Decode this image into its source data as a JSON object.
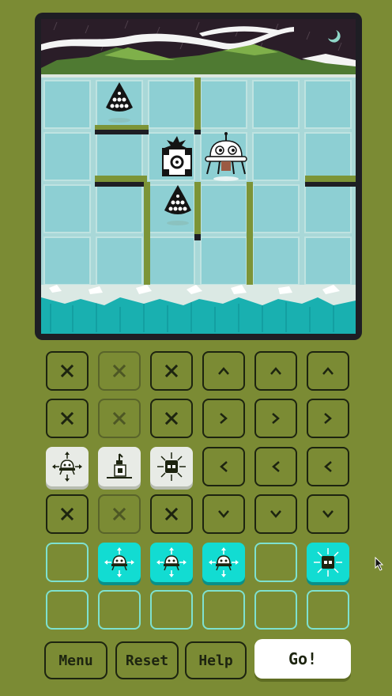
{
  "board": {
    "rows": 4,
    "cols": 6,
    "pieces": [
      {
        "name": "spiked-bomb-robot-icon",
        "row": 0,
        "col": 1
      },
      {
        "name": "spiked-bomb-robot-icon",
        "row": 2,
        "col": 2
      },
      {
        "name": "target-crate-icon",
        "row": 1,
        "col": 2
      },
      {
        "name": "white-ufo-robot-icon",
        "row": 1,
        "col": 3
      }
    ]
  },
  "grid": {
    "rows": [
      [
        {
          "kind": "x",
          "icon": "x-icon"
        },
        {
          "kind": "x-dim",
          "icon": "x-icon"
        },
        {
          "kind": "x",
          "icon": "x-icon"
        },
        {
          "kind": "arrow",
          "icon": "arrow-up-icon"
        },
        {
          "kind": "arrow",
          "icon": "arrow-up-icon"
        },
        {
          "kind": "arrow",
          "icon": "arrow-up-icon"
        }
      ],
      [
        {
          "kind": "x",
          "icon": "x-icon"
        },
        {
          "kind": "x-dim",
          "icon": "x-icon"
        },
        {
          "kind": "x",
          "icon": "x-icon"
        },
        {
          "kind": "arrow",
          "icon": "arrow-right-icon"
        },
        {
          "kind": "arrow",
          "icon": "arrow-right-icon"
        },
        {
          "kind": "arrow",
          "icon": "arrow-right-icon"
        }
      ],
      [
        {
          "kind": "tile-white",
          "icon": "robot-move-icon"
        },
        {
          "kind": "tile-white",
          "icon": "robot-push-icon"
        },
        {
          "kind": "tile-white",
          "icon": "block-burst-icon"
        },
        {
          "kind": "arrow",
          "icon": "arrow-left-icon"
        },
        {
          "kind": "arrow",
          "icon": "arrow-left-icon"
        },
        {
          "kind": "arrow",
          "icon": "arrow-left-icon"
        }
      ],
      [
        {
          "kind": "x",
          "icon": "x-icon"
        },
        {
          "kind": "x-dim",
          "icon": "x-icon"
        },
        {
          "kind": "x",
          "icon": "x-icon"
        },
        {
          "kind": "arrow",
          "icon": "arrow-down-icon"
        },
        {
          "kind": "arrow",
          "icon": "arrow-down-icon"
        },
        {
          "kind": "arrow",
          "icon": "arrow-down-icon"
        }
      ],
      [
        {
          "kind": "empty",
          "icon": ""
        },
        {
          "kind": "tile-cyan",
          "icon": "robot-move-icon"
        },
        {
          "kind": "tile-cyan",
          "icon": "robot-move-icon"
        },
        {
          "kind": "tile-cyan",
          "icon": "robot-move-icon"
        },
        {
          "kind": "empty",
          "icon": ""
        },
        {
          "kind": "tile-cyan",
          "icon": "block-burst-icon"
        }
      ],
      [
        {
          "kind": "empty",
          "icon": ""
        },
        {
          "kind": "empty",
          "icon": ""
        },
        {
          "kind": "empty",
          "icon": ""
        },
        {
          "kind": "empty",
          "icon": ""
        },
        {
          "kind": "empty",
          "icon": ""
        },
        {
          "kind": "empty",
          "icon": ""
        }
      ]
    ]
  },
  "buttons": {
    "menu": "Menu",
    "reset": "Reset",
    "help": "Help",
    "go": "Go!"
  },
  "colors": {
    "background": "#7b8b34",
    "tile_cyan": "#12dcd2",
    "tile_white": "#e8ebe6",
    "ice": "#a9d8d8",
    "water": "#19b0b0"
  }
}
